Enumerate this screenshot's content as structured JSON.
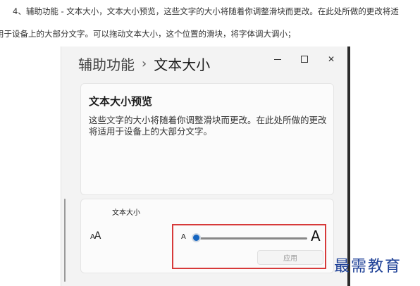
{
  "article": {
    "line1": "4、辅助功能 - 文本大小，文本大小预览，这些文字的大小将随着你调整滑块而更改。在此处所做的更改将适",
    "line2": "用于设备上的大部分文字。可以拖动文本大小，这个位置的滑块，将字体调大调小；"
  },
  "window": {
    "breadcrumb_parent": "辅助功能",
    "breadcrumb_separator": "›",
    "breadcrumb_current": "文本大小",
    "controls": {
      "close_label": "✕"
    }
  },
  "preview": {
    "title": "文本大小预览",
    "text": "这些文字的大小将随着你调整滑块而更改。在此处所做的更改将适用于设备上的大部分文字。"
  },
  "text_size": {
    "label": "文本大小",
    "icon_small": "A",
    "icon_large": "A",
    "slider_min_label": "A",
    "slider_max_label": "A",
    "slider_value_fraction": 0,
    "apply_label": "应用",
    "accent_color": "#1565c0"
  },
  "highlight_color": "#d73a3a",
  "watermark": "最需教育"
}
